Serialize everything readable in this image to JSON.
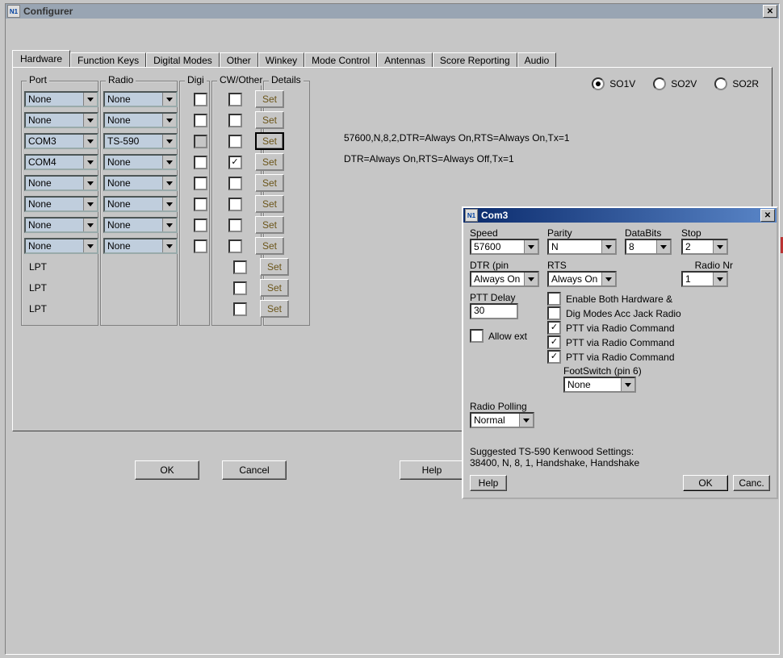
{
  "window": {
    "title": "Configurer",
    "icon_text": "N1"
  },
  "tabs": [
    "Hardware",
    "Function Keys",
    "Digital Modes",
    "Other",
    "Winkey",
    "Mode Control",
    "Antennas",
    "Score Reporting",
    "Audio"
  ],
  "groups": {
    "port": "Port",
    "radio": "Radio",
    "digi": "Digi",
    "cw": "CW/Other",
    "details": "Details"
  },
  "rows": [
    {
      "port": "None",
      "radio": "None",
      "digi": false,
      "cw": false,
      "set": "Set",
      "note": ""
    },
    {
      "port": "None",
      "radio": "None",
      "digi": false,
      "cw": false,
      "set": "Set",
      "note": ""
    },
    {
      "port": "COM3",
      "radio": "TS-590",
      "digi": "disabled",
      "cw": false,
      "set_active": true,
      "set": "Set",
      "note": "57600,N,8,2,DTR=Always On,RTS=Always On,Tx=1"
    },
    {
      "port": "COM4",
      "radio": "None",
      "digi": false,
      "cw": true,
      "set": "Set",
      "note": "DTR=Always On,RTS=Always Off,Tx=1"
    },
    {
      "port": "None",
      "radio": "None",
      "digi": false,
      "cw": false,
      "set": "Set",
      "note": ""
    },
    {
      "port": "None",
      "radio": "None",
      "digi": false,
      "cw": false,
      "set": "Set",
      "note": ""
    },
    {
      "port": "None",
      "radio": "None",
      "digi": false,
      "cw": false,
      "set": "Set",
      "note": ""
    },
    {
      "port": "None",
      "radio": "None",
      "digi": false,
      "cw": false,
      "set": "Set",
      "note": ""
    }
  ],
  "lpt_rows": [
    {
      "label": "LPT",
      "cw": false,
      "set": "Set"
    },
    {
      "label": "LPT",
      "cw": false,
      "set": "Set"
    },
    {
      "label": "LPT",
      "cw": false,
      "set": "Set"
    }
  ],
  "so_radios": [
    {
      "label": "SO1V",
      "checked": true
    },
    {
      "label": "SO2V",
      "checked": false
    },
    {
      "label": "SO2R",
      "checked": false
    }
  ],
  "bottom": {
    "ok": "OK",
    "cancel": "Cancel",
    "help": "Help"
  },
  "dlg": {
    "title": "Com3",
    "icon_text": "N1",
    "speed": {
      "label": "Speed",
      "value": "57600"
    },
    "parity": {
      "label": "Parity",
      "value": "N"
    },
    "databits": {
      "label": "DataBits",
      "value": "8"
    },
    "stop": {
      "label": "Stop",
      "value": "2"
    },
    "dtr": {
      "label": "DTR (pin",
      "value": "Always On"
    },
    "rts": {
      "label": "RTS",
      "value": "Always On"
    },
    "radionr": {
      "label": "Radio Nr",
      "value": "1"
    },
    "ptt": {
      "label": "PTT Delay",
      "value": "30"
    },
    "allow": {
      "label": "Allow ext",
      "checked": false
    },
    "opts": [
      {
        "label": "Enable Both Hardware &",
        "checked": false
      },
      {
        "label": "Dig Modes Acc Jack Radio",
        "checked": false
      },
      {
        "label": "PTT via Radio Command",
        "checked": true
      },
      {
        "label": "PTT via Radio Command",
        "checked": true
      },
      {
        "label": "PTT via Radio Command",
        "checked": true
      }
    ],
    "foot": {
      "label": "FootSwitch (pin 6)",
      "value": "None"
    },
    "polling": {
      "label": "Radio Polling",
      "value": "Normal"
    },
    "suggest1": "Suggested TS-590 Kenwood Settings:",
    "suggest2": "38400, N, 8, 1, Handshake, Handshake",
    "btn_help": "Help",
    "btn_ok": "OK",
    "btn_cancel": "Canc."
  }
}
